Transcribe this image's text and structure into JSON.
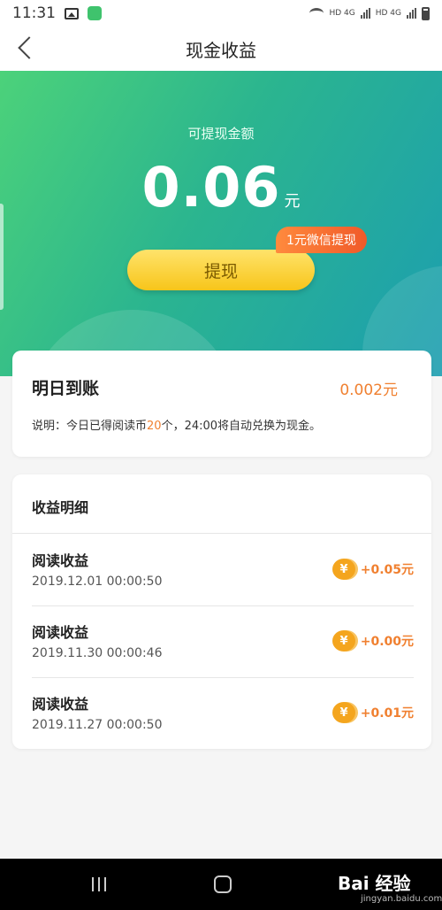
{
  "status_bar": {
    "time": "11:31",
    "net1": "HD 4G",
    "net2": "HD 4G"
  },
  "nav": {
    "title": "现金收益"
  },
  "hero": {
    "label": "可提现金额",
    "amount": "0.06",
    "unit": "元",
    "withdraw_label": "提现",
    "badge": "1元微信提现"
  },
  "tomorrow": {
    "title": "明日到账",
    "amount": "0.002元",
    "note_prefix": "说明：今日已得阅读币",
    "note_count": "20",
    "note_suffix": "个，24:00将自动兑换为现金。"
  },
  "details": {
    "title": "收益明细",
    "coin_symbol": "¥",
    "rows": [
      {
        "title": "阅读收益",
        "date": "2019.12.01 00:00:50",
        "amount": "+0.05元"
      },
      {
        "title": "阅读收益",
        "date": "2019.11.30 00:00:46",
        "amount": "+0.00元"
      },
      {
        "title": "阅读收益",
        "date": "2019.11.27 00:00:50",
        "amount": "+0.01元"
      }
    ]
  },
  "watermark": {
    "brand": "Bai 经验",
    "url": "jingyan.baidu.com"
  },
  "colors": {
    "accent_orange": "#f08030",
    "hero_green": "#4cd27a",
    "hero_teal": "#1c9eb0",
    "button_yellow": "#f7c51a"
  }
}
